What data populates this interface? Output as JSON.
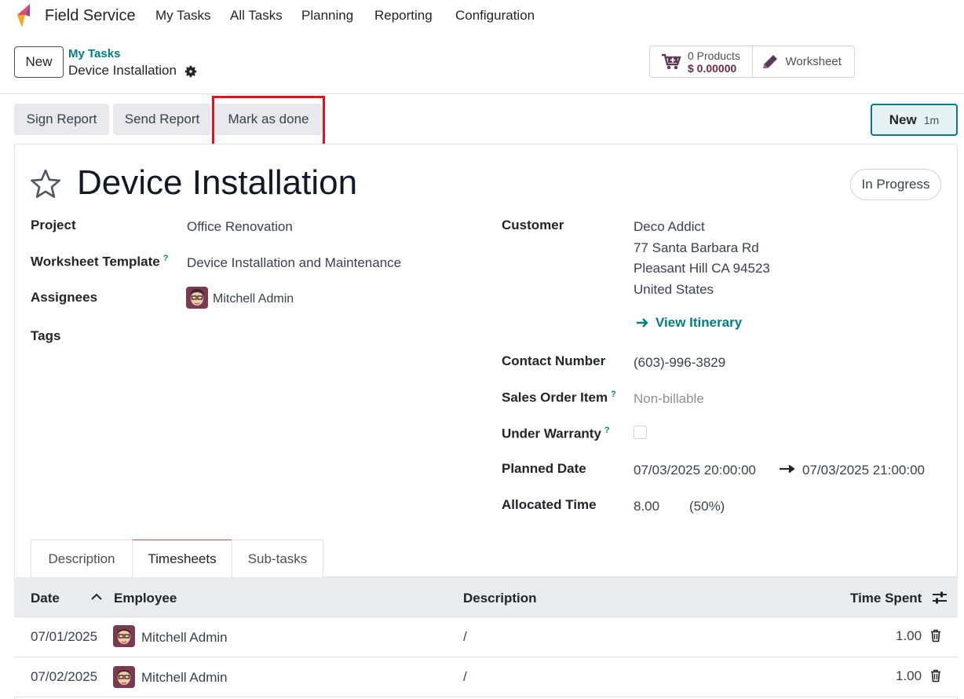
{
  "nav": {
    "app_name": "Field Service",
    "items": [
      {
        "label": "My Tasks"
      },
      {
        "label": "All Tasks"
      },
      {
        "label": "Planning"
      },
      {
        "label": "Reporting"
      },
      {
        "label": "Configuration"
      }
    ]
  },
  "control": {
    "new_label": "New",
    "breadcrumb_parent": "My Tasks",
    "breadcrumb_current": "Device Installation",
    "products_count": "0 Products",
    "products_amount": "$ 0.00000",
    "worksheet_label": "Worksheet"
  },
  "status_bar": {
    "sign_report": "Sign Report",
    "send_report": "Send Report",
    "mark_as_done": "Mark as done",
    "timer_new": "New",
    "timer_value": "1m"
  },
  "form": {
    "title": "Device Installation",
    "stage": "In Progress",
    "project_label": "Project",
    "project_value": "Office Renovation",
    "worksheet_template_label": "Worksheet Template",
    "worksheet_template_value": "Device Installation and Maintenance",
    "assignees_label": "Assignees",
    "assignee_name": "Mitchell Admin",
    "tags_label": "Tags",
    "customer_label": "Customer",
    "customer_name": "Deco Addict",
    "customer_street": "77 Santa Barbara Rd",
    "customer_city": "Pleasant Hill CA 94523",
    "customer_country": "United States",
    "view_itinerary": "View Itinerary",
    "contact_label": "Contact Number",
    "contact_value": "(603)-996-3829",
    "sales_order_label": "Sales Order Item",
    "sales_order_value": "Non-billable",
    "warranty_label": "Under Warranty",
    "planned_date_label": "Planned Date",
    "planned_start": "07/03/2025 20:00:00",
    "planned_end": "07/03/2025 21:00:00",
    "allocated_label": "Allocated Time",
    "allocated_value": "8.00",
    "allocated_percent": "(50%)",
    "help_mark": "?"
  },
  "tabs": [
    {
      "label": "Description"
    },
    {
      "label": "Timesheets"
    },
    {
      "label": "Sub-tasks"
    }
  ],
  "timesheets": {
    "headers": {
      "date": "Date",
      "employee": "Employee",
      "description": "Description",
      "time_spent": "Time Spent"
    },
    "rows": [
      {
        "date": "07/01/2025",
        "employee": "Mitchell Admin",
        "description": "/",
        "time_spent": "1.00"
      },
      {
        "date": "07/02/2025",
        "employee": "Mitchell Admin",
        "description": "/",
        "time_spent": "1.00"
      }
    ]
  },
  "colors": {
    "accent": "#017e84",
    "highlight": "#e0141e",
    "brand": "#714b67"
  }
}
